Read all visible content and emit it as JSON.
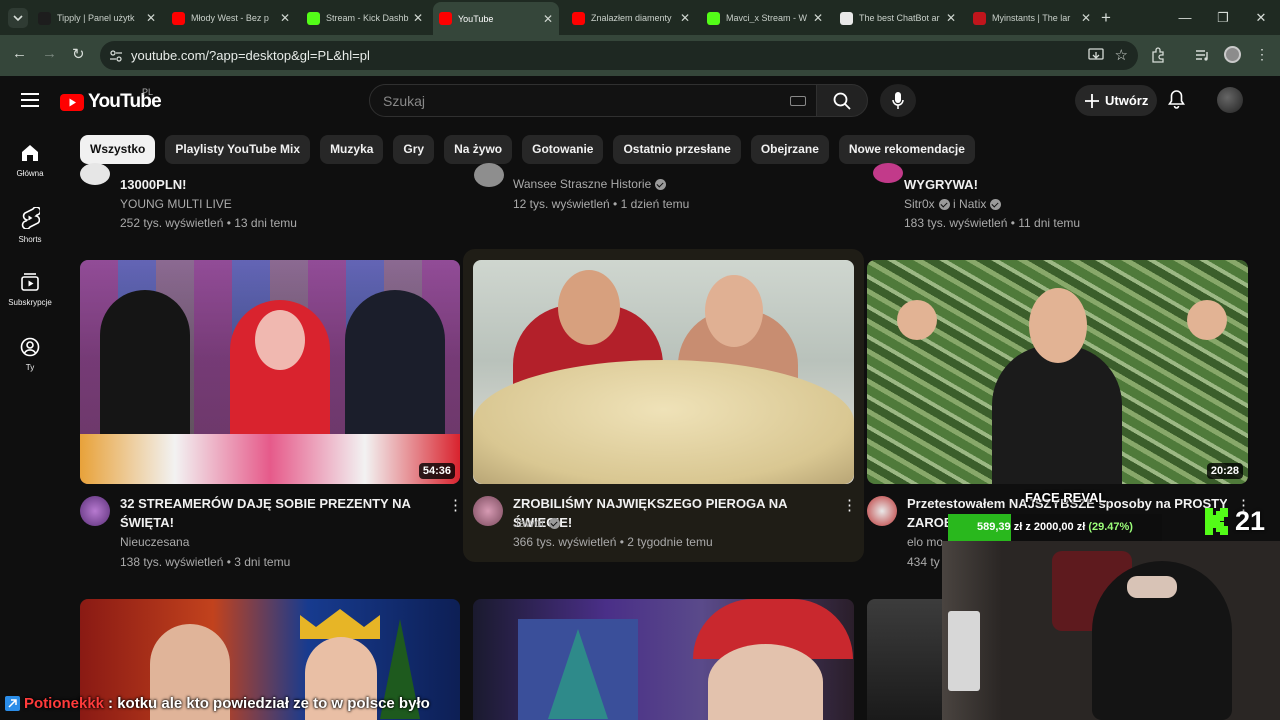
{
  "browser": {
    "tabs": [
      {
        "title": "Tipply | Panel użytk",
        "favicon": "tipply-icon",
        "fav_color": "#1d1d1d",
        "active": false
      },
      {
        "title": "Młody West - Bez p",
        "favicon": "youtube-icon",
        "fav_color": "#ff0000",
        "active": false
      },
      {
        "title": "Stream - Kick Dashb",
        "favicon": "kick-icon",
        "fav_color": "#53fc18",
        "active": false
      },
      {
        "title": "YouTube",
        "favicon": "youtube-icon",
        "fav_color": "#ff0000",
        "active": true
      },
      {
        "title": "Znalazłem diamenty",
        "favicon": "youtube-icon",
        "fav_color": "#ff0000",
        "active": false
      },
      {
        "title": "Mavci_x Stream - W",
        "favicon": "kick-icon",
        "fav_color": "#53fc18",
        "active": false
      },
      {
        "title": "The best ChatBot ar",
        "favicon": "chatbot-icon",
        "fav_color": "#e8e8e8",
        "active": false
      },
      {
        "title": "Myinstants | The lar",
        "favicon": "myinstants-icon",
        "fav_color": "#c0151c",
        "active": false
      }
    ],
    "url": "youtube.com/?app=desktop&gl=PL&hl=pl"
  },
  "masthead": {
    "logo_text": "YouTube",
    "country_code": "PL",
    "search_placeholder": "Szukaj",
    "create_label": "Utwórz"
  },
  "guide": [
    {
      "label": "Główna",
      "icon": "home-icon"
    },
    {
      "label": "Shorts",
      "icon": "shorts-icon"
    },
    {
      "label": "Subskrypcje",
      "icon": "subscriptions-icon"
    },
    {
      "label": "Ty",
      "icon": "you-icon"
    }
  ],
  "chips": [
    {
      "label": "Wszystko",
      "active": true
    },
    {
      "label": "Playlisty YouTube Mix",
      "active": false
    },
    {
      "label": "Muzyka",
      "active": false
    },
    {
      "label": "Gry",
      "active": false
    },
    {
      "label": "Na żywo",
      "active": false
    },
    {
      "label": "Gotowanie",
      "active": false
    },
    {
      "label": "Ostatnio przesłane",
      "active": false
    },
    {
      "label": "Obejrzane",
      "active": false
    },
    {
      "label": "Nowe rekomendacje",
      "active": false
    }
  ],
  "row_top": [
    {
      "title": "13000PLN!",
      "channel": "YOUNG MULTI LIVE",
      "verified": false,
      "meta": "252 tys. wyświetleń • 13 dni temu"
    },
    {
      "title": "",
      "channel": "Wansee Straszne Historie",
      "verified": true,
      "meta": "12 tys. wyświetleń • 1 dzień temu"
    },
    {
      "title": "WYGRYWA!",
      "channel": "Sitr0x",
      "channel2": "i Natix",
      "verified": true,
      "meta": "183 tys. wyświetleń • 11 dni temu"
    }
  ],
  "row_main": [
    {
      "title1": "32 STREAMERÓW DAJĘ SOBIE PREZENTY NA",
      "title2": "ŚWIĘTA!",
      "channel": "Nieuczesana",
      "verified": false,
      "meta": "138 tys. wyświetleń • 3 dni temu",
      "duration": "54:36"
    },
    {
      "title1": "ZROBILIŚMY NAJWIĘKSZEGO PIEROGA NA ŚWIECIE!",
      "title2": "",
      "channel": "Jawor",
      "verified": true,
      "meta": "366 tys. wyświetleń • 2 tygodnie temu",
      "duration": ""
    },
    {
      "title1": "Przetestowałem NAJSZYBSZE sposoby na PROSTY",
      "title2": "ZAROB",
      "channel": "elo mo",
      "verified": false,
      "meta": "434 ty",
      "duration": "20:28"
    }
  ],
  "overlay": {
    "face_reveal": "FACE REVAL",
    "donation_text": "589,39 zł z 2000,00 zł",
    "donation_percent": "(29.47%)",
    "donation_progress": 0.2947,
    "kick_count": "21",
    "chat_user": "Potionekkk",
    "chat_message": ": kotku ale kto powiedział ze to w polsce było"
  }
}
